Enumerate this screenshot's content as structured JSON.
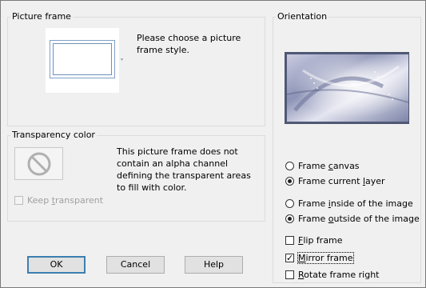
{
  "picture_frame": {
    "title": "Picture frame",
    "prompt": "Please choose a picture frame style."
  },
  "transparency": {
    "title": "Transparency color",
    "message": "This picture frame does not contain an alpha channel defining the transparent areas to fill with color.",
    "keep_transparent_pre": "Keep ",
    "keep_transparent_ul": "t",
    "keep_transparent_post": "ransparent"
  },
  "orientation": {
    "title": "Orientation",
    "frame_canvas_pre": "Frame ",
    "frame_canvas_ul": "c",
    "frame_canvas_post": "anvas",
    "frame_layer_pre": "Frame current ",
    "frame_layer_ul": "l",
    "frame_layer_post": "ayer",
    "inside_pre": "Frame ",
    "inside_ul": "i",
    "inside_post": "nside of the image",
    "outside_pre": "Frame ",
    "outside_ul": "o",
    "outside_post": "utside of the image",
    "flip_ul": "F",
    "flip_post": "lip frame",
    "mirror_ul": "M",
    "mirror_post": "irror frame",
    "rotate_ul": "R",
    "rotate_post": "otate frame right",
    "mirror_checkmark": "✓"
  },
  "buttons": {
    "ok": "OK",
    "cancel": "Cancel",
    "help": "Help"
  }
}
